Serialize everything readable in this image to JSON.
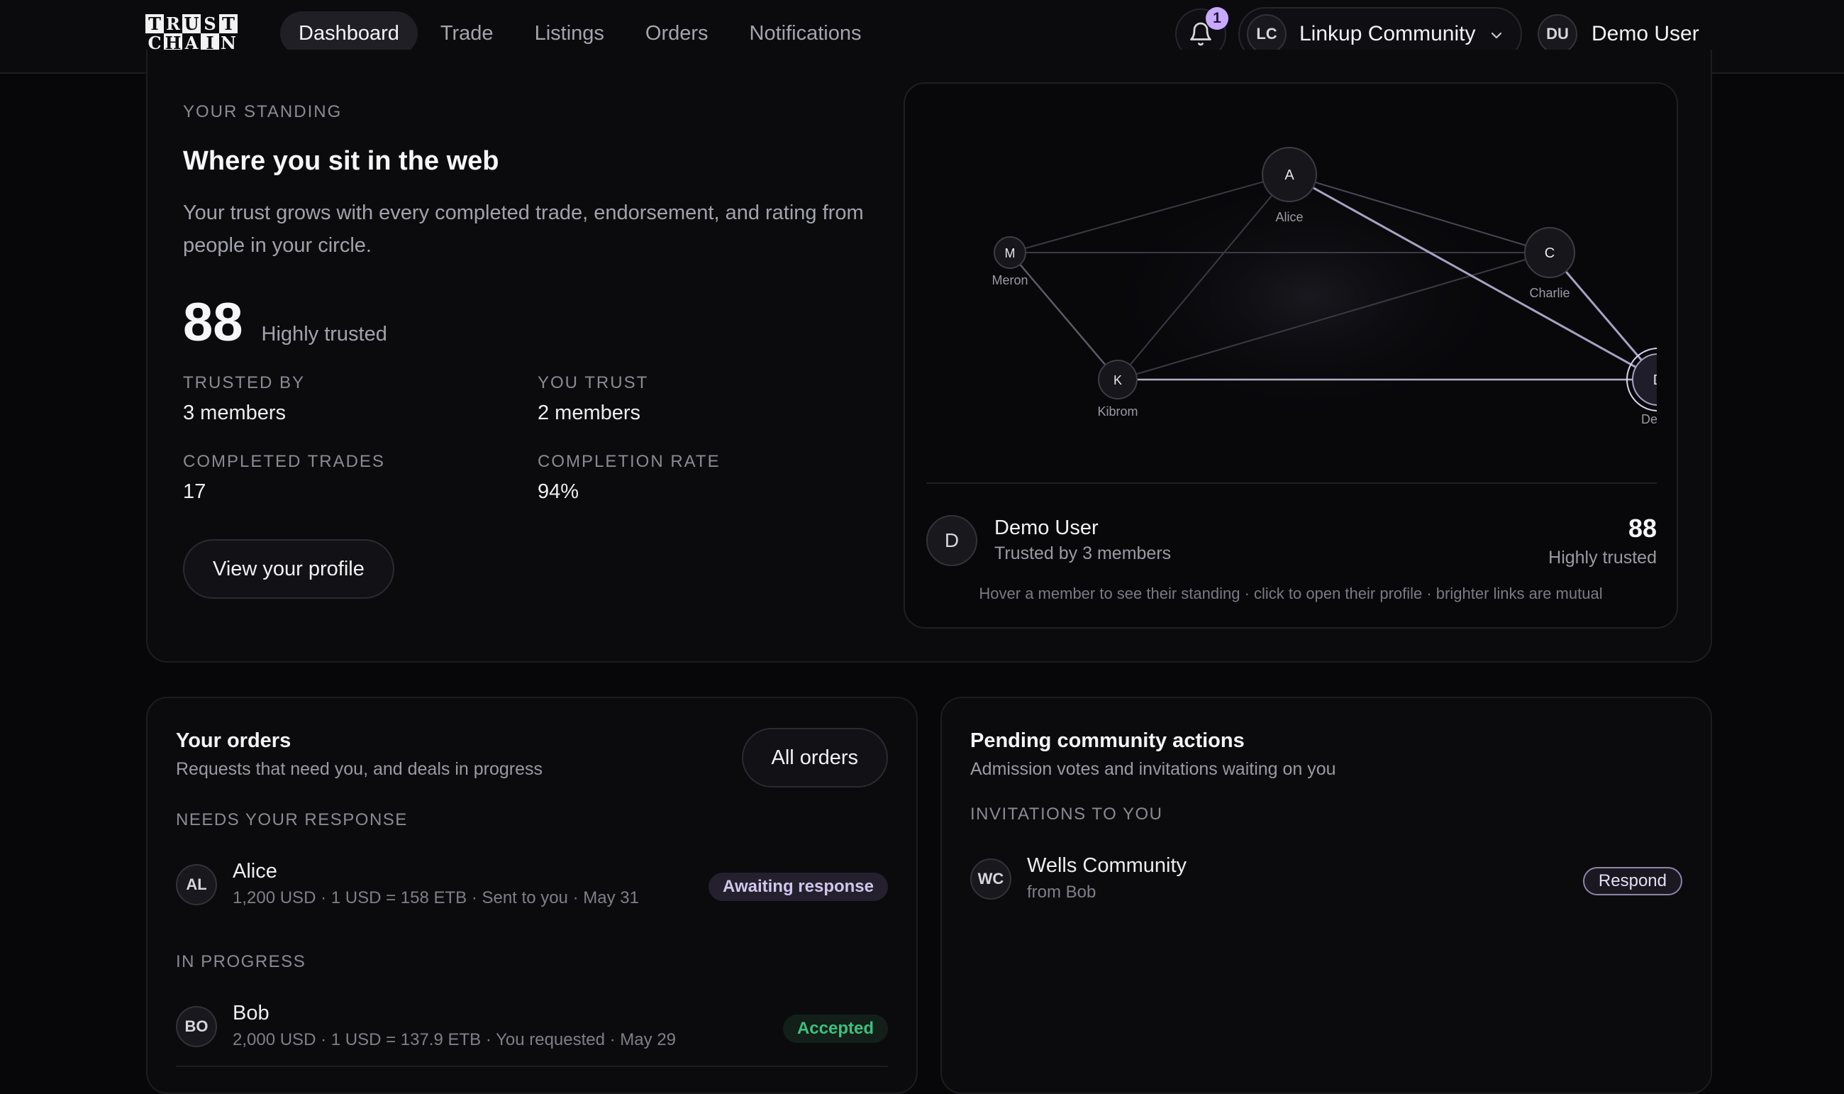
{
  "app": {
    "logo_letters": [
      "T",
      "R",
      "U",
      "S",
      "T",
      "C",
      "H",
      "A",
      "I",
      "N"
    ]
  },
  "nav": {
    "items": [
      {
        "label": "Dashboard",
        "active": true
      },
      {
        "label": "Trade",
        "active": false
      },
      {
        "label": "Listings",
        "active": false
      },
      {
        "label": "Orders",
        "active": false
      },
      {
        "label": "Notifications",
        "active": false
      }
    ],
    "notification_count": "1",
    "community": {
      "initials": "LC",
      "name": "Linkup Community"
    },
    "user": {
      "initials": "DU",
      "name": "Demo User"
    }
  },
  "standing": {
    "eyebrow": "YOUR STANDING",
    "title": "Where you sit in the web",
    "description": "Your trust grows with every completed trade, endorsement, and rating from people in your circle.",
    "score": "88",
    "score_label": "Highly trusted",
    "stats": {
      "trusted_by_label": "TRUSTED BY",
      "trusted_by_value": "3 members",
      "you_trust_label": "YOU TRUST",
      "you_trust_value": "2 members",
      "completed_trades_label": "COMPLETED TRADES",
      "completed_trades_value": "17",
      "completion_rate_label": "COMPLETION RATE",
      "completion_rate_value": "94%"
    },
    "profile_button": "View your profile"
  },
  "graph": {
    "nodes": [
      {
        "id": "alice",
        "letter": "A",
        "name": "Alice"
      },
      {
        "id": "charlie",
        "letter": "C",
        "name": "Charlie"
      },
      {
        "id": "meron",
        "letter": "M",
        "name": "Meron"
      },
      {
        "id": "kibrom",
        "letter": "K",
        "name": "Kibrom"
      },
      {
        "id": "demo",
        "letter": "D",
        "name": "Demo"
      }
    ],
    "selected": {
      "initial": "D",
      "name": "Demo User",
      "subtitle": "Trusted by 3 members",
      "score": "88",
      "score_label": "Highly trusted"
    },
    "hint": "Hover a member to see their standing · click to open their profile · brighter links are mutual"
  },
  "orders": {
    "title": "Your orders",
    "subtitle": "Requests that need you, and deals in progress",
    "all_button": "All orders",
    "needs_response_label": "NEEDS YOUR RESPONSE",
    "in_progress_label": "IN PROGRESS",
    "needs_response": [
      {
        "initials": "AL",
        "name": "Alice",
        "detail": "1,200 USD · 1 USD = 158 ETB · Sent to you · May 31",
        "status": "Awaiting response"
      }
    ],
    "in_progress": [
      {
        "initials": "BO",
        "name": "Bob",
        "detail": "2,000 USD · 1 USD = 137.9 ETB · You requested · May 29",
        "status": "Accepted"
      }
    ]
  },
  "pending": {
    "title": "Pending community actions",
    "subtitle": "Admission votes and invitations waiting on you",
    "invitations_label": "INVITATIONS TO YOU",
    "invitations": [
      {
        "initials": "WC",
        "name": "Wells Community",
        "detail": "from Bob",
        "action": "Respond"
      }
    ]
  }
}
